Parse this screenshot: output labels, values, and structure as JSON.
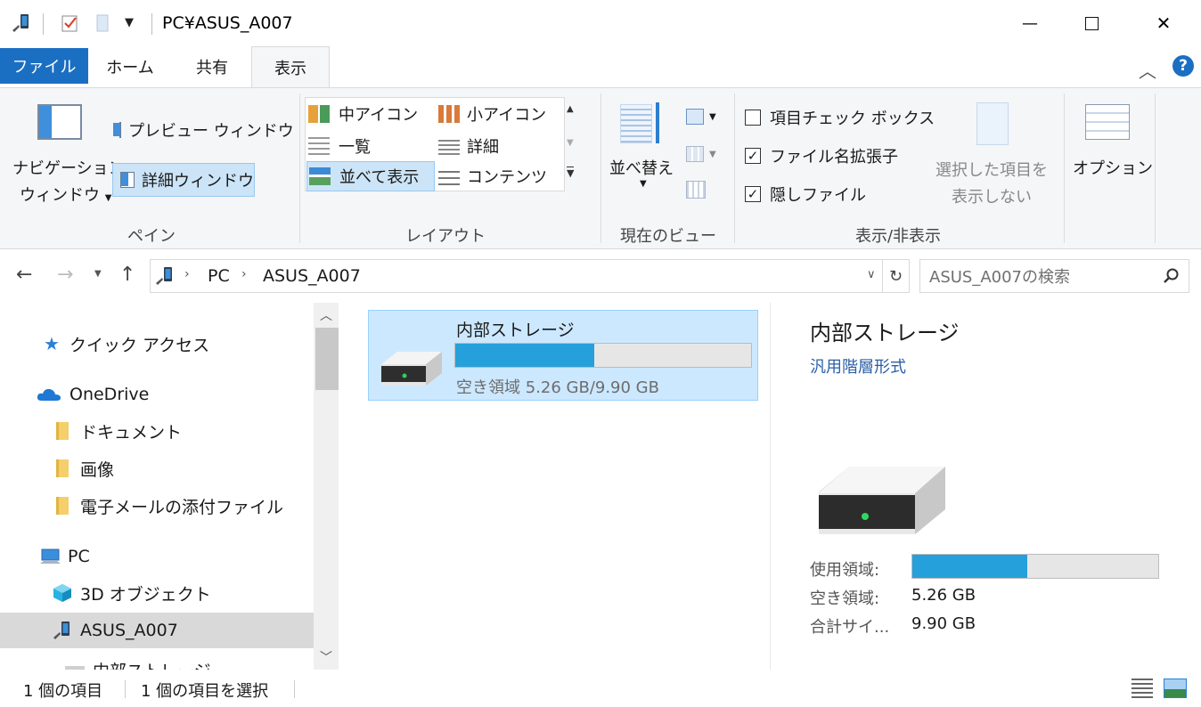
{
  "window": {
    "title": "PC¥ASUS_A007",
    "minimize": "—",
    "maximize": "☐",
    "close": "✕"
  },
  "tabs": [
    {
      "label": "ファイル"
    },
    {
      "label": "ホーム"
    },
    {
      "label": "共有"
    },
    {
      "label": "表示"
    }
  ],
  "ribbon": {
    "pane": {
      "nav_pane": "ナビゲーション",
      "nav_pane2": "ウィンドウ",
      "preview_pane": "プレビュー ウィンドウ",
      "details_pane": "詳細ウィンドウ",
      "group": "ペイン"
    },
    "layout": {
      "medium_icons": "中アイコン",
      "small_icons": "小アイコン",
      "list": "一覧",
      "details": "詳細",
      "tiles": "並べて表示",
      "content": "コンテンツ",
      "group": "レイアウト"
    },
    "current_view": {
      "sort": "並べ替え",
      "group": "現在のビュー"
    },
    "show_hide": {
      "item_checkboxes": "項目チェック ボックス",
      "file_extensions": "ファイル名拡張子",
      "hidden_files": "隠しファイル",
      "item_checkboxes_checked": false,
      "file_extensions_checked": true,
      "hidden_files_checked": true,
      "hide_selected_1": "選択した項目を",
      "hide_selected_2": "表示しない",
      "group": "表示/非表示"
    },
    "options": "オプション"
  },
  "address": {
    "crumbs": [
      "PC",
      "ASUS_A007"
    ],
    "search_placeholder": "ASUS_A007の検索"
  },
  "navpane": {
    "items": [
      {
        "label": "クイック アクセス"
      },
      {
        "label": "OneDrive"
      },
      {
        "label": "ドキュメント"
      },
      {
        "label": "画像"
      },
      {
        "label": "電子メールの添付ファイル"
      },
      {
        "label": "PC"
      },
      {
        "label": "3D オブジェクト"
      },
      {
        "label": "ASUS_A007"
      },
      {
        "label": "内部ストレージ"
      }
    ]
  },
  "content": {
    "tile_name": "内部ストレージ",
    "tile_free": "空き領域 5.26 GB/9.90 GB",
    "used_fraction": 0.469
  },
  "preview": {
    "name": "内部ストレージ",
    "type": "汎用階層形式",
    "used_label": "使用領域:",
    "free_label": "空き領域:",
    "free_value": "5.26 GB",
    "total_label": "合計サイ...",
    "total_value": "9.90 GB"
  },
  "status": {
    "count": "1 個の項目",
    "selected": "1 個の項目を選択"
  },
  "colors": {
    "accent": "#1b6fc2",
    "bar": "#26a0da",
    "selection": "#cce8ff"
  }
}
